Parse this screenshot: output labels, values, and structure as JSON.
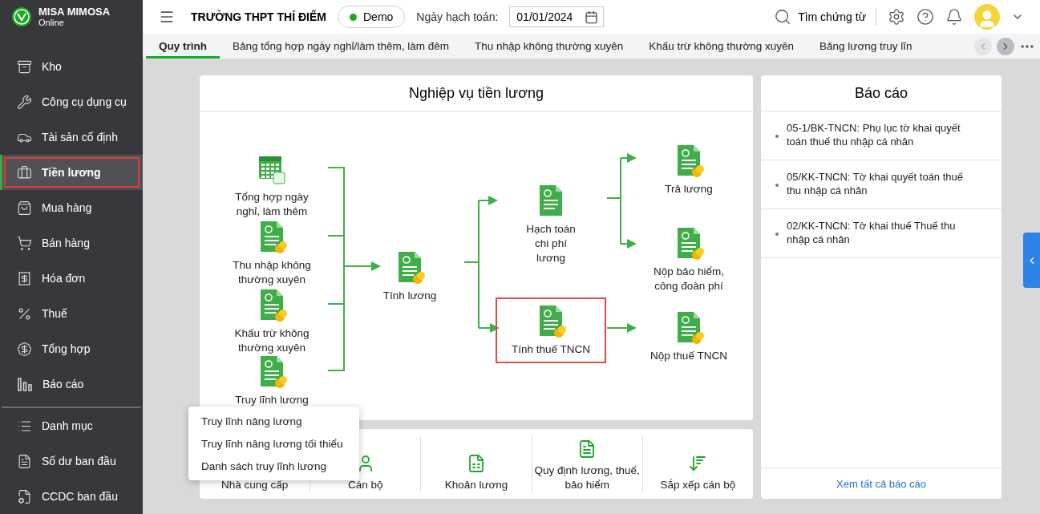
{
  "app": {
    "name": "MISA MIMOSA",
    "edition": "Online"
  },
  "header": {
    "school": "TRƯỜNG THPT THÍ ĐIỂM",
    "mode": "Demo",
    "date_label": "Ngày hạch toán:",
    "date_value": "01/01/2024",
    "search": "Tìm chứng từ"
  },
  "sidebar": {
    "sections": [
      [
        {
          "label": "Kho",
          "selected": false
        },
        {
          "label": "Công cụ dụng cụ",
          "selected": false
        },
        {
          "label": "Tài sản cố định",
          "selected": false
        },
        {
          "label": "Tiền lương",
          "selected": true
        },
        {
          "label": "Mua hàng",
          "selected": false
        },
        {
          "label": "Bán hàng",
          "selected": false
        },
        {
          "label": "Hóa đơn",
          "selected": false
        },
        {
          "label": "Thuế",
          "selected": false
        },
        {
          "label": "Tổng hợp",
          "selected": false
        },
        {
          "label": "Báo cáo",
          "selected": false
        }
      ],
      [
        {
          "label": "Danh mục",
          "selected": false
        },
        {
          "label": "Số dư ban đầu",
          "selected": false
        },
        {
          "label": "CCDC ban đầu",
          "selected": false
        }
      ]
    ]
  },
  "tabs": [
    {
      "label": "Quy trình",
      "selected": true
    },
    {
      "label": "Bảng tổng hợp ngày nghỉ/làm thêm, làm đêm",
      "selected": false
    },
    {
      "label": "Thu nhập không thường xuyên",
      "selected": false
    },
    {
      "label": "Khấu trừ không thường xuyên",
      "selected": false
    },
    {
      "label": "Bảng lương truy lĩn",
      "selected": false
    }
  ],
  "diagram": {
    "title": "Nghiệp vụ tiền lương",
    "nodes": [
      {
        "label": "Tổng hợp ngày nghỉ, làm thêm",
        "highlighted": false
      },
      {
        "label": "Thu nhập không thường xuyên",
        "highlighted": false
      },
      {
        "label": "Khấu trừ không thường xuyên",
        "highlighted": false
      },
      {
        "label": "Truy lĩnh lương",
        "highlighted": false
      },
      {
        "label": "Tính lương",
        "highlighted": false
      },
      {
        "label": "Hạch toán chi phí lương",
        "highlighted": false
      },
      {
        "label": "Tính thuế TNCN",
        "highlighted": true
      },
      {
        "label": "Trả lương",
        "highlighted": false
      },
      {
        "label": "Nộp bảo hiểm, công đoàn phí",
        "highlighted": false
      },
      {
        "label": "Nộp thuế TNCN",
        "highlighted": false
      }
    ]
  },
  "shortcuts": [
    {
      "label": "Nhà cung cấp"
    },
    {
      "label": "Cán bộ"
    },
    {
      "label": "Khoản lương"
    },
    {
      "label": "Quy định lương, thuế, bảo hiểm"
    },
    {
      "label": "Sắp xếp cán bộ"
    }
  ],
  "popup_menu": [
    "Truy lĩnh nâng lương",
    "Truy lĩnh nâng lương tối thiểu",
    "Danh sách truy lĩnh lương"
  ],
  "reports": {
    "title": "Báo cáo",
    "items": [
      "05-1/BK-TNCN: Phụ lục tờ khai quyết toán thuế thu nhập cá nhân",
      "05/KK-TNCN: Tờ khai quyết toán thuế thu nhập cá nhân",
      "02/KK-TNCN: Tờ khai thuế Thuế thu nhập cá nhân"
    ],
    "link": "Xem tất cả báo cáo"
  }
}
